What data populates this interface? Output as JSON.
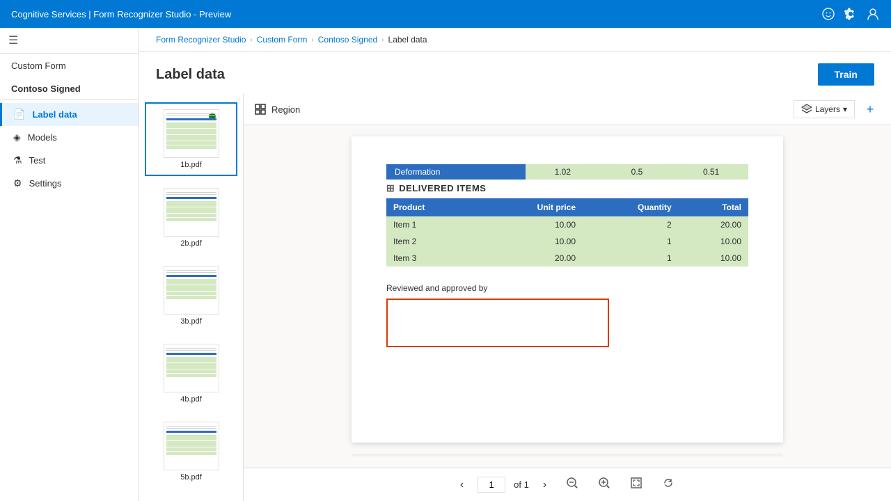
{
  "app": {
    "title": "Cognitive Services | Form Recognizer Studio - Preview"
  },
  "topbar": {
    "title": "Cognitive Services | Form Recognizer Studio - Preview",
    "icons": [
      "smiley-icon",
      "settings-icon",
      "user-icon"
    ]
  },
  "breadcrumb": {
    "items": [
      {
        "label": "Form Recognizer Studio",
        "link": true
      },
      {
        "label": "Custom Form",
        "link": true
      },
      {
        "label": "Contoso Signed",
        "link": true
      },
      {
        "label": "Label data",
        "link": false
      }
    ]
  },
  "page": {
    "title": "Label data",
    "train_button": "Train"
  },
  "sidebar": {
    "collapse_label": "≡",
    "top_item": "Custom Form",
    "project": "Contoso Signed",
    "nav": [
      {
        "label": "Label data",
        "icon": "📄",
        "active": true
      },
      {
        "label": "Models",
        "icon": "🔷",
        "active": false
      },
      {
        "label": "Test",
        "icon": "🧪",
        "active": false
      },
      {
        "label": "Settings",
        "icon": "⚙️",
        "active": false
      }
    ]
  },
  "region_toolbar": {
    "label": "Region",
    "layers_label": "Layers",
    "plus_label": "+"
  },
  "files": [
    {
      "name": "1b.pdf",
      "active": true
    },
    {
      "name": "2b.pdf",
      "active": false
    },
    {
      "name": "3b.pdf",
      "active": false
    },
    {
      "name": "4b.pdf",
      "active": false
    },
    {
      "name": "5b.pdf",
      "active": false
    }
  ],
  "document": {
    "deformation": {
      "label": "Deformation",
      "values": [
        "1.02",
        "0.5",
        "0.51"
      ]
    },
    "delivered_items_title": "DELIVERED ITEMS",
    "table": {
      "headers": [
        "Product",
        "Unit price",
        "Quantity",
        "Total"
      ],
      "rows": [
        {
          "product": "Item 1",
          "unit_price": "10.00",
          "quantity": "2",
          "total": "20.00"
        },
        {
          "product": "Item 2",
          "unit_price": "10.00",
          "quantity": "1",
          "total": "10.00"
        },
        {
          "product": "Item 3",
          "unit_price": "20.00",
          "quantity": "1",
          "total": "10.00"
        }
      ]
    },
    "signature_label": "Reviewed and approved by",
    "signature_placeholder": ""
  },
  "pagination": {
    "current_page": "1",
    "total_pages": "1",
    "of_label": "of"
  }
}
